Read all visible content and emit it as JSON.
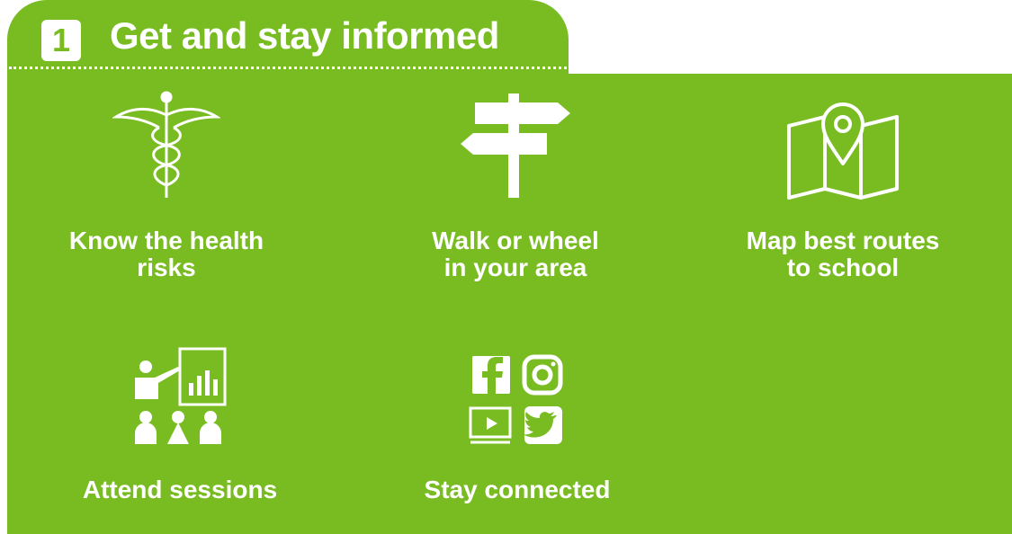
{
  "header": {
    "number": "1",
    "title": "Get and stay informed"
  },
  "colors": {
    "panel": "#78bc21",
    "text": "#ffffff"
  },
  "items": [
    {
      "line1": "Know the health",
      "line2": "risks",
      "icon": "caduceus-icon"
    },
    {
      "line1": "Walk or wheel",
      "line2": "in your area",
      "icon": "signpost-icon"
    },
    {
      "line1": "Map best routes",
      "line2": "to school",
      "icon": "map-pin-icon"
    },
    {
      "line1": "Attend sessions",
      "icon": "presentation-icon"
    },
    {
      "line1": "Stay connected",
      "icon": "social-media-icon"
    }
  ]
}
